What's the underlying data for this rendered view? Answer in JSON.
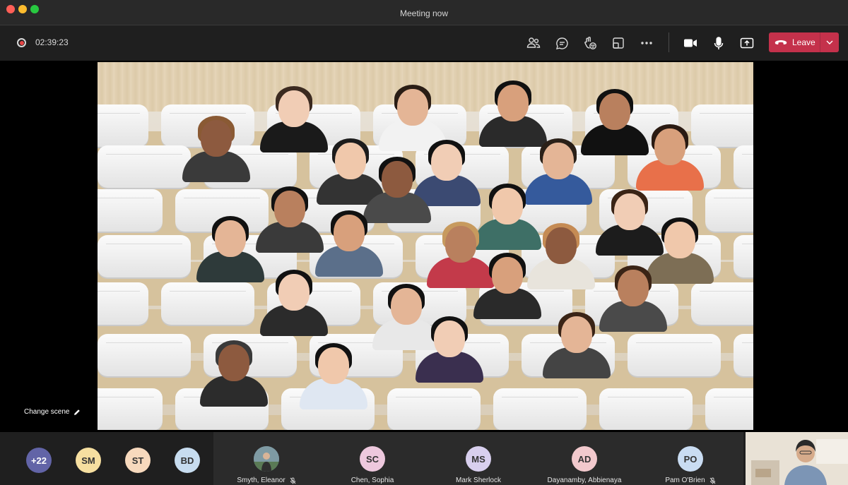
{
  "window": {
    "title": "Meeting now"
  },
  "toolbar": {
    "timer": "02:39:23",
    "leave_label": "Leave",
    "icons": [
      "people-icon",
      "chat-icon",
      "reactions-icon",
      "rooms-icon",
      "more-icon",
      "camera-icon",
      "mic-icon",
      "share-icon"
    ]
  },
  "stage": {
    "change_scene_label": "Change scene"
  },
  "strip": {
    "overflow": {
      "label": "+22",
      "color": "#6264a7"
    },
    "avatars": [
      {
        "initials": "SM",
        "color": "#f6dfa0"
      },
      {
        "initials": "ST",
        "color": "#f7d9bd"
      },
      {
        "initials": "BD",
        "color": "#c7dcef"
      }
    ],
    "tiles": [
      {
        "initials": "",
        "name": "Smyth, Eleanor",
        "muted": true,
        "photo": true
      },
      {
        "initials": "SC",
        "name": "Chen, Sophia",
        "muted": false,
        "color": "#edc8dd"
      },
      {
        "initials": "MS",
        "name": "Mark Sherlock",
        "muted": false,
        "color": "#d8cfee"
      },
      {
        "initials": "AD",
        "name": "Dayanamby, Abbienaya",
        "muted": false,
        "color": "#f2c9cd"
      },
      {
        "initials": "PO",
        "name": "Pam O'Brien",
        "muted": true,
        "color": "#c9dcf2"
      }
    ]
  }
}
